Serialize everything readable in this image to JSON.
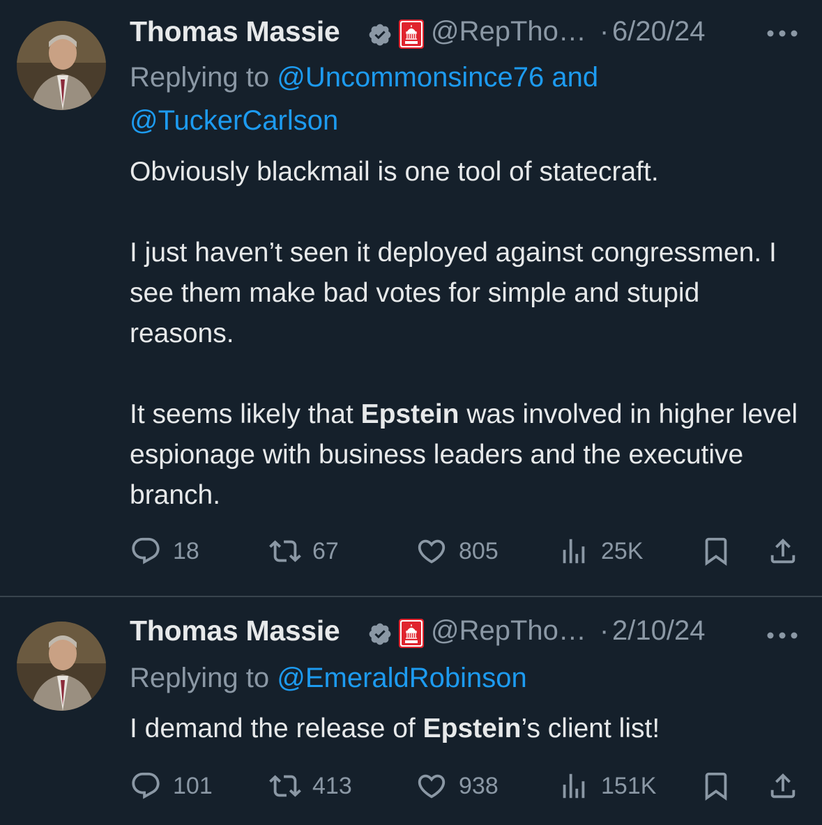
{
  "tweets": [
    {
      "author": {
        "name": "Thomas Massie",
        "handle": "@RepTho…",
        "separator": "·",
        "date": "6/20/24"
      },
      "replying": {
        "prefix": "Replying to ",
        "mention_1": "@Uncommonsince76",
        "joiner": " and ",
        "mention_2": "@TuckerCarlson"
      },
      "body": {
        "p1": "Obviously blackmail is one tool of statecraft.",
        "p2": "I just haven’t seen it deployed against congressmen. I see them make bad votes for simple and stupid reasons.",
        "p3_pre": "It seems likely that ",
        "p3_bold": "Epstein",
        "p3_post": " was involved in higher level espionage with business leaders and the executive branch."
      },
      "stats": {
        "replies": "18",
        "reposts": "67",
        "likes": "805",
        "views": "25K"
      }
    },
    {
      "author": {
        "name": "Thomas Massie",
        "handle": "@RepTho…",
        "separator": "·",
        "date": "2/10/24"
      },
      "replying": {
        "prefix": "Replying to ",
        "mention_1": "@EmeraldRobinson"
      },
      "body": {
        "pre": "I demand the release of ",
        "bold": "Epstein",
        "post": "’s client list!"
      },
      "stats": {
        "replies": "101",
        "reposts": "413",
        "likes": "938",
        "views": "151K"
      }
    }
  ],
  "icons": {
    "verified": "verified-badge-icon",
    "affiliate": "house-gop-affiliate-icon",
    "more": "more-dots-icon",
    "reply": "reply-bubble-icon",
    "repost": "repost-arrows-icon",
    "like": "heart-icon",
    "views": "views-bars-icon",
    "bookmark": "bookmark-icon",
    "share": "share-upload-icon"
  },
  "colors": {
    "background": "#15202b",
    "text": "#e7e9ea",
    "muted": "#8b98a5",
    "link": "#1d9bf0",
    "divider": "#38444d",
    "affiliate_red": "#e0242e"
  }
}
